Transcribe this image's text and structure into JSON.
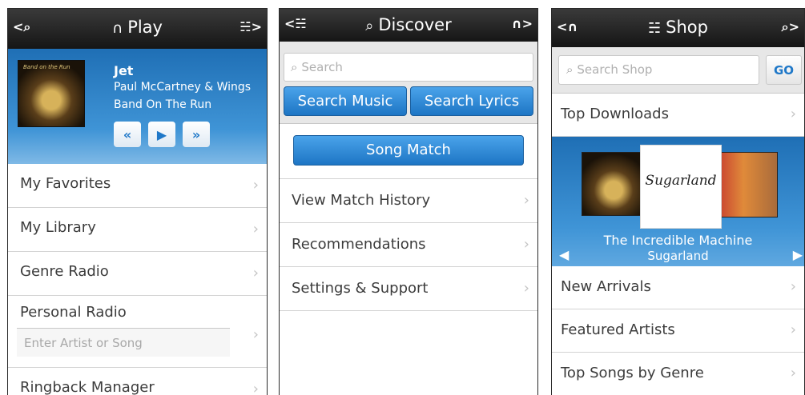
{
  "play_screen": {
    "nav_left": "<⌕",
    "title_icon": "∩",
    "title": "Play",
    "nav_right": "☵>",
    "now_playing": {
      "art_caption": "Band on the Run",
      "track": "Jet",
      "artist": "Paul McCartney & Wings",
      "album": "Band On The Run",
      "rewind": "«",
      "play": "▶",
      "forward": "»"
    },
    "menu": {
      "favorites": "My Favorites",
      "library": "My Library",
      "genre_radio": "Genre Radio",
      "personal_radio": "Personal Radio",
      "personal_radio_placeholder": "Enter Artist or Song",
      "ringback": "Ringback Manager"
    },
    "chevron": "›"
  },
  "discover_screen": {
    "nav_left": "<☵",
    "title_icon": "⌕",
    "title": "Discover",
    "nav_right": "∩>",
    "search_placeholder": "Search",
    "search_icon": "⌕",
    "buttons": {
      "search_music": "Search Music",
      "search_lyrics": "Search Lyrics",
      "song_match": "Song Match"
    },
    "menu": {
      "match_history": "View Match History",
      "recommendations": "Recommendations",
      "settings": "Settings & Support"
    }
  },
  "shop_screen": {
    "nav_left": "<∩",
    "title_icon": "☵",
    "title": "Shop",
    "nav_right": "⌕>",
    "search_placeholder": "Search Shop",
    "search_icon": "⌕",
    "go_label": "GO",
    "menu": {
      "top_downloads": "Top Downloads",
      "new_arrivals": "New Arrivals",
      "featured_artists": "Featured Artists",
      "top_songs_by_genre": "Top Songs by Genre"
    },
    "carousel": {
      "featured_cover_text": "Sugarland",
      "album_title": "The Incredible Machine",
      "artist": "Sugarland",
      "prev": "◀",
      "next": "▶"
    }
  },
  "colors": {
    "accent_blue": "#1f78c8",
    "titlebar": "#1e1e1e",
    "menu_text": "#3c3c3c"
  }
}
